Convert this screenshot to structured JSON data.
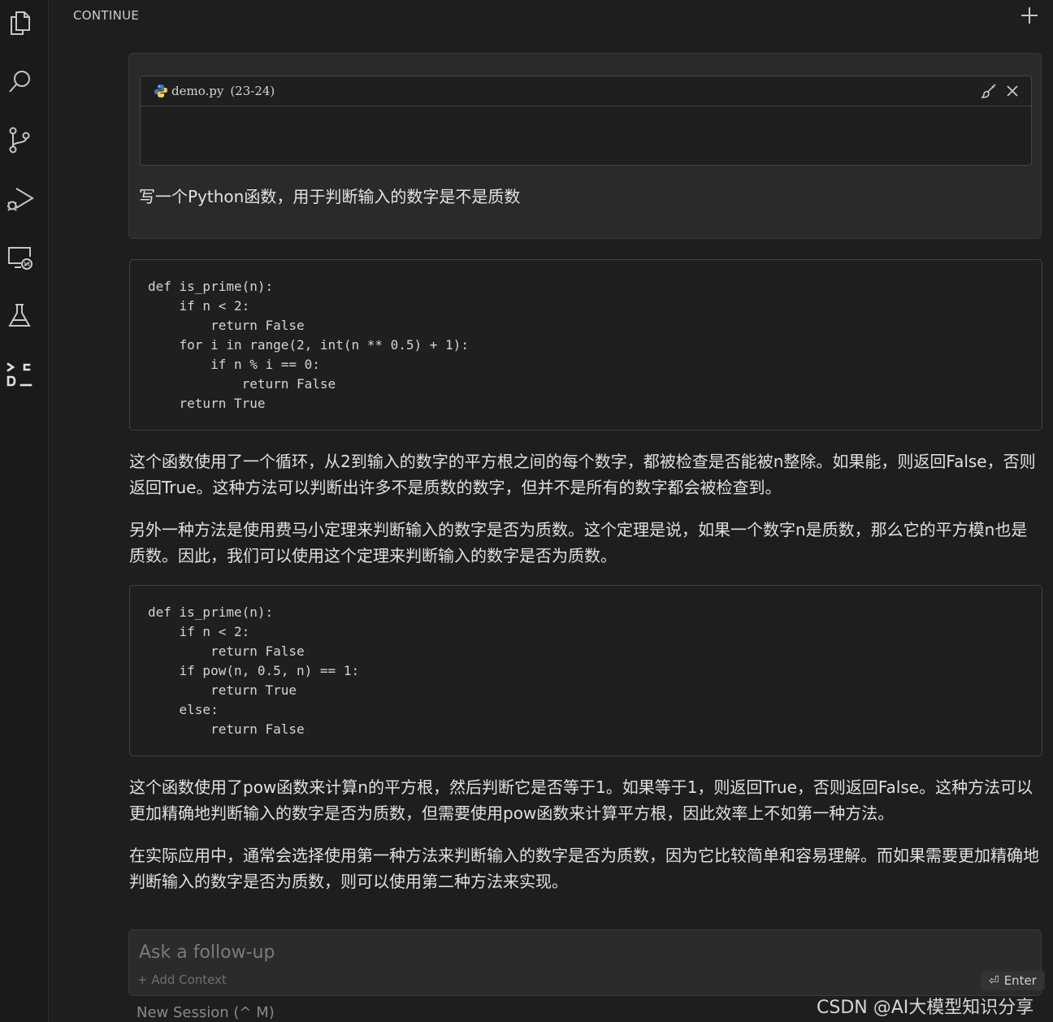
{
  "header": {
    "title": "CONTINUE"
  },
  "context": {
    "file_name": "demo.py",
    "line_range": "(23-24)"
  },
  "user_message": "写一个Python函数，用于判断输入的数字是不是质数",
  "code_block_1": {
    "lines": [
      "def is_prime(n):",
      "    if n < 2:",
      "        return False",
      "    for i in range(2, int(n ** 0.5) + 1):",
      "        if n % i == 0:",
      "            return False",
      "    return True"
    ]
  },
  "paragraph_1": "这个函数使用了一个循环，从2到输入的数字的平方根之间的每个数字，都被检查是否能被n整除。如果能，则返回False，否则返回True。这种方法可以判断出许多不是质数的数字，但并不是所有的数字都会被检查到。",
  "paragraph_2": "另外一种方法是使用费马小定理来判断输入的数字是否为质数。这个定理是说，如果一个数字n是质数，那么它的平方模n也是质数。因此，我们可以使用这个定理来判断输入的数字是否为质数。",
  "code_block_2": {
    "lines": [
      "def is_prime(n):",
      "    if n < 2:",
      "        return False",
      "    if pow(n, 0.5, n) == 1:",
      "        return True",
      "    else:",
      "        return False"
    ]
  },
  "paragraph_3": "这个函数使用了pow函数来计算n的平方根，然后判断它是否等于1。如果等于1，则返回True，否则返回False。这种方法可以更加精确地判断输入的数字是否为质数，但需要使用pow函数来计算平方根，因此效率上不如第一种方法。",
  "paragraph_4": "在实际应用中，通常会选择使用第一种方法来判断输入的数字是否为质数，因为它比较简单和容易理解。而如果需要更加精确地判断输入的数字是否为质数，则可以使用第二种方法来实现。",
  "input": {
    "placeholder": "Ask a follow-up",
    "add_context": "+ Add Context",
    "enter_label": "Enter",
    "enter_glyph": "⏎"
  },
  "new_session": "New Session (^ M)",
  "watermark": "CSDN @AI大模型知识分享",
  "colors": {
    "background": "#1e1e1e",
    "panel": "#2a2a2a",
    "code_background": "#1f1f1f",
    "text": "#d4d4d4",
    "icon": "#c5c5c5"
  }
}
